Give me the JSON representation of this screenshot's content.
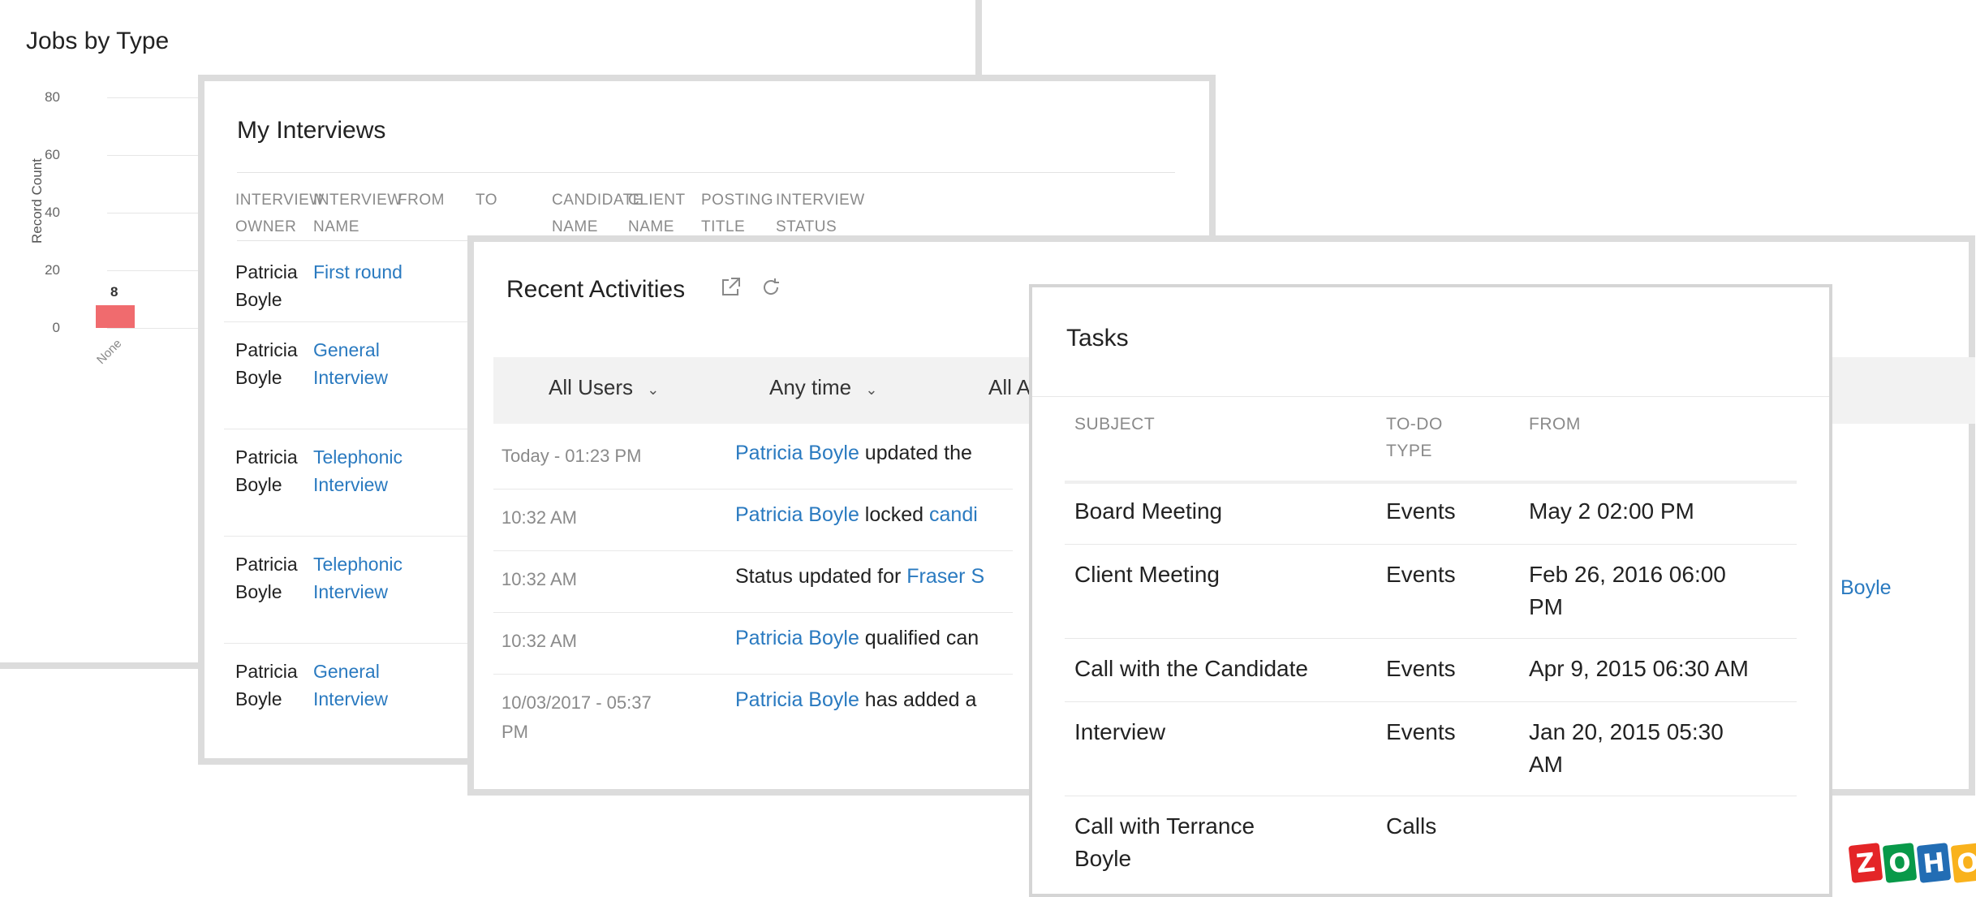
{
  "jobs_by_type": {
    "title": "Jobs by Type",
    "chart_data": {
      "type": "bar",
      "categories": [
        "None"
      ],
      "values": [
        8
      ],
      "ylabel": "Record Count",
      "ylim": [
        0,
        80
      ],
      "yticks": [
        "0",
        "20",
        "40",
        "60",
        "80"
      ],
      "bar_labels": [
        "8"
      ],
      "bar_color": "#f06b6e"
    }
  },
  "my_interviews": {
    "title": "My Interviews",
    "columns": [
      [
        "INTERVIEW",
        "OWNER"
      ],
      [
        "INTERVIEW",
        "NAME"
      ],
      [
        "FROM",
        ""
      ],
      [
        "TO",
        ""
      ],
      [
        "CANDIDATE",
        "NAME"
      ],
      [
        "CLIENT",
        "NAME"
      ],
      [
        "POSTING",
        "TITLE"
      ],
      [
        "INTERVIEW",
        "STATUS"
      ]
    ],
    "rows": [
      {
        "owner": [
          "Patricia",
          "Boyle"
        ],
        "name": [
          "First round",
          ""
        ]
      },
      {
        "owner": [
          "Patricia",
          "Boyle"
        ],
        "name": [
          "General",
          "Interview"
        ]
      },
      {
        "owner": [
          "Patricia",
          "Boyle"
        ],
        "name": [
          "Telephonic",
          "Interview"
        ]
      },
      {
        "owner": [
          "Patricia",
          "Boyle"
        ],
        "name": [
          "Telephonic",
          "Interview"
        ]
      },
      {
        "owner": [
          "Patricia",
          "Boyle"
        ],
        "name": [
          "General",
          "Interview"
        ]
      }
    ]
  },
  "recent_activities": {
    "title": "Recent Activities",
    "filters": [
      "All Users",
      "Any time",
      "All A"
    ],
    "items": [
      {
        "time": [
          "Today - 01:23 PM",
          ""
        ],
        "parts": [
          {
            "t": "Patricia Boyle",
            "link": true
          },
          {
            "t": " updated the",
            "link": false
          }
        ]
      },
      {
        "time": [
          "10:32 AM",
          ""
        ],
        "parts": [
          {
            "t": "Patricia Boyle",
            "link": true
          },
          {
            "t": " locked ",
            "link": false
          },
          {
            "t": "candi",
            "link": true
          }
        ]
      },
      {
        "time": [
          "10:32 AM",
          ""
        ],
        "parts": [
          {
            "t": "Status updated for ",
            "link": false
          },
          {
            "t": "Fraser S",
            "link": true
          }
        ]
      },
      {
        "time": [
          "10:32 AM",
          ""
        ],
        "parts": [
          {
            "t": "Patricia Boyle",
            "link": true
          },
          {
            "t": " qualified can",
            "link": false
          }
        ]
      },
      {
        "time": [
          "10/03/2017 - 05:37",
          "PM"
        ],
        "parts": [
          {
            "t": "Patricia Boyle",
            "link": true
          },
          {
            "t": " has added a",
            "link": false
          }
        ]
      }
    ],
    "right_edge_text": "Boyle"
  },
  "tasks": {
    "title": "Tasks",
    "columns": [
      [
        "SUBJECT",
        ""
      ],
      [
        "TO-DO",
        "TYPE"
      ],
      [
        "FROM",
        ""
      ]
    ],
    "rows": [
      {
        "subject": [
          "Board Meeting",
          ""
        ],
        "type": "Events",
        "from": [
          "May 2 02:00 PM",
          ""
        ]
      },
      {
        "subject": [
          "Client Meeting",
          ""
        ],
        "type": "Events",
        "from": [
          "Feb 26, 2016 06:00",
          "PM"
        ]
      },
      {
        "subject": [
          "Call with the Candidate",
          ""
        ],
        "type": "Events",
        "from": [
          "Apr 9, 2015 06:30 AM",
          ""
        ]
      },
      {
        "subject": [
          "Interview",
          ""
        ],
        "type": "Events",
        "from": [
          "Jan 20, 2015 05:30",
          "AM"
        ]
      },
      {
        "subject": [
          "Call with Terrance",
          "Boyle"
        ],
        "type": "Calls",
        "from": [
          "",
          ""
        ]
      }
    ]
  },
  "logo": {
    "letters": [
      "Z",
      "O",
      "H",
      "O"
    ],
    "colors": [
      "#e42527",
      "#089949",
      "#226db4",
      "#f9b21d"
    ]
  },
  "colors": {
    "link": "#2a7ac0",
    "card_border": "#dcdcdc",
    "filter_bg": "#f2f2f2"
  }
}
